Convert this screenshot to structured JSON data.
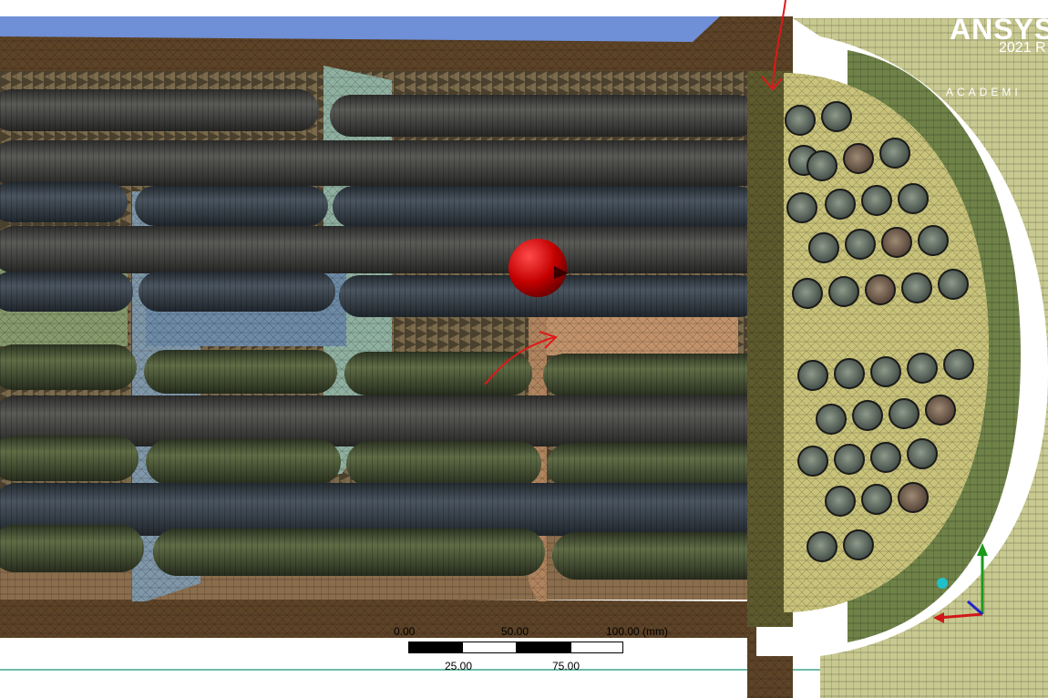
{
  "branding": {
    "product": "ANSYS",
    "release": "2021 R",
    "edition": "ACADEMI"
  },
  "scale_bar": {
    "tick_top_labels": [
      "0.00",
      "50.00",
      "100.00 (mm)"
    ],
    "tick_bottom_labels": [
      "25.00",
      "75.00"
    ]
  },
  "colors": {
    "background_sky": "#6f8fd6",
    "shell_wall": "#5d4327",
    "tubesheet": "#c8c27a",
    "tube_dark": "#4a4a48",
    "tube_green": "#54613f",
    "baffle_blue": "#7f97a9",
    "baffle_teal": "#8fb0a0",
    "baffle_orange": "#b0845e",
    "channel_green": "#7d8c5a",
    "annotation_red": "#e01818",
    "highlight_sphere": "#cc0000"
  }
}
